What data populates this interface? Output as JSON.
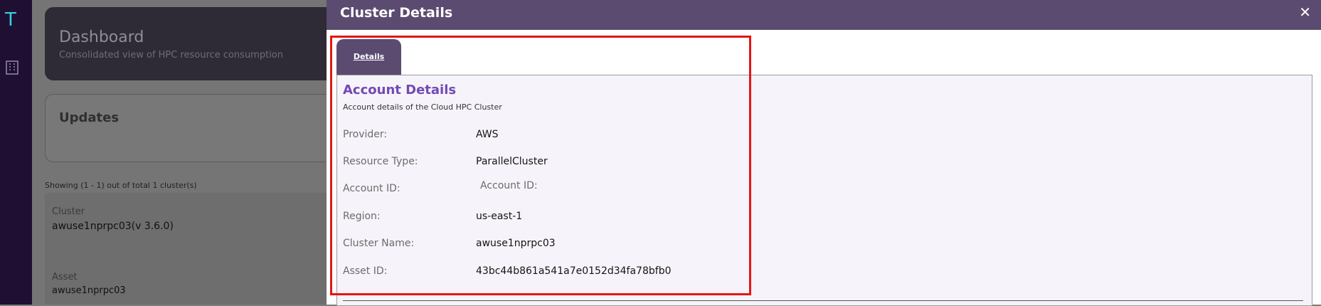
{
  "sidebar": {
    "logo_glyph": "T",
    "items": [
      {
        "icon": "building-icon"
      }
    ]
  },
  "dashboard": {
    "title": "Dashboard",
    "subtitle": "Consolidated view of HPC resource consumption",
    "updates_title": "Updates",
    "showing_text": "Showing (1 - 1) out of total 1 cluster(s)",
    "cluster_label": "Cluster",
    "cluster_value": "awuse1nprpc03(v 3.6.0)",
    "asset_label": "Asset",
    "asset_value": "awuse1nprpc03"
  },
  "modal": {
    "title": "Cluster Details",
    "close_icon": "close-icon",
    "tabs": [
      {
        "label": "Details",
        "active": true
      }
    ],
    "section_title": "Account Details",
    "section_subtitle": "Account details of the Cloud HPC Cluster",
    "rows": [
      {
        "label": "Provider:",
        "value": "AWS"
      },
      {
        "label": "Resource Type:",
        "value": "ParallelCluster"
      },
      {
        "label": "Account ID:",
        "placeholder": "Account ID:"
      },
      {
        "label": "Region:",
        "value": "us-east-1"
      },
      {
        "label": "Cluster Name:",
        "value": "awuse1nprpc03"
      },
      {
        "label": "Asset ID:",
        "value": "43bc44b861a541a7e0152d34fa78bfb0"
      }
    ]
  },
  "colors": {
    "header": "#5c4b70",
    "accent_title": "#7348b5",
    "highlight": "#e31515",
    "sidebar": "#1f0f33",
    "logo": "#37d1d9"
  }
}
